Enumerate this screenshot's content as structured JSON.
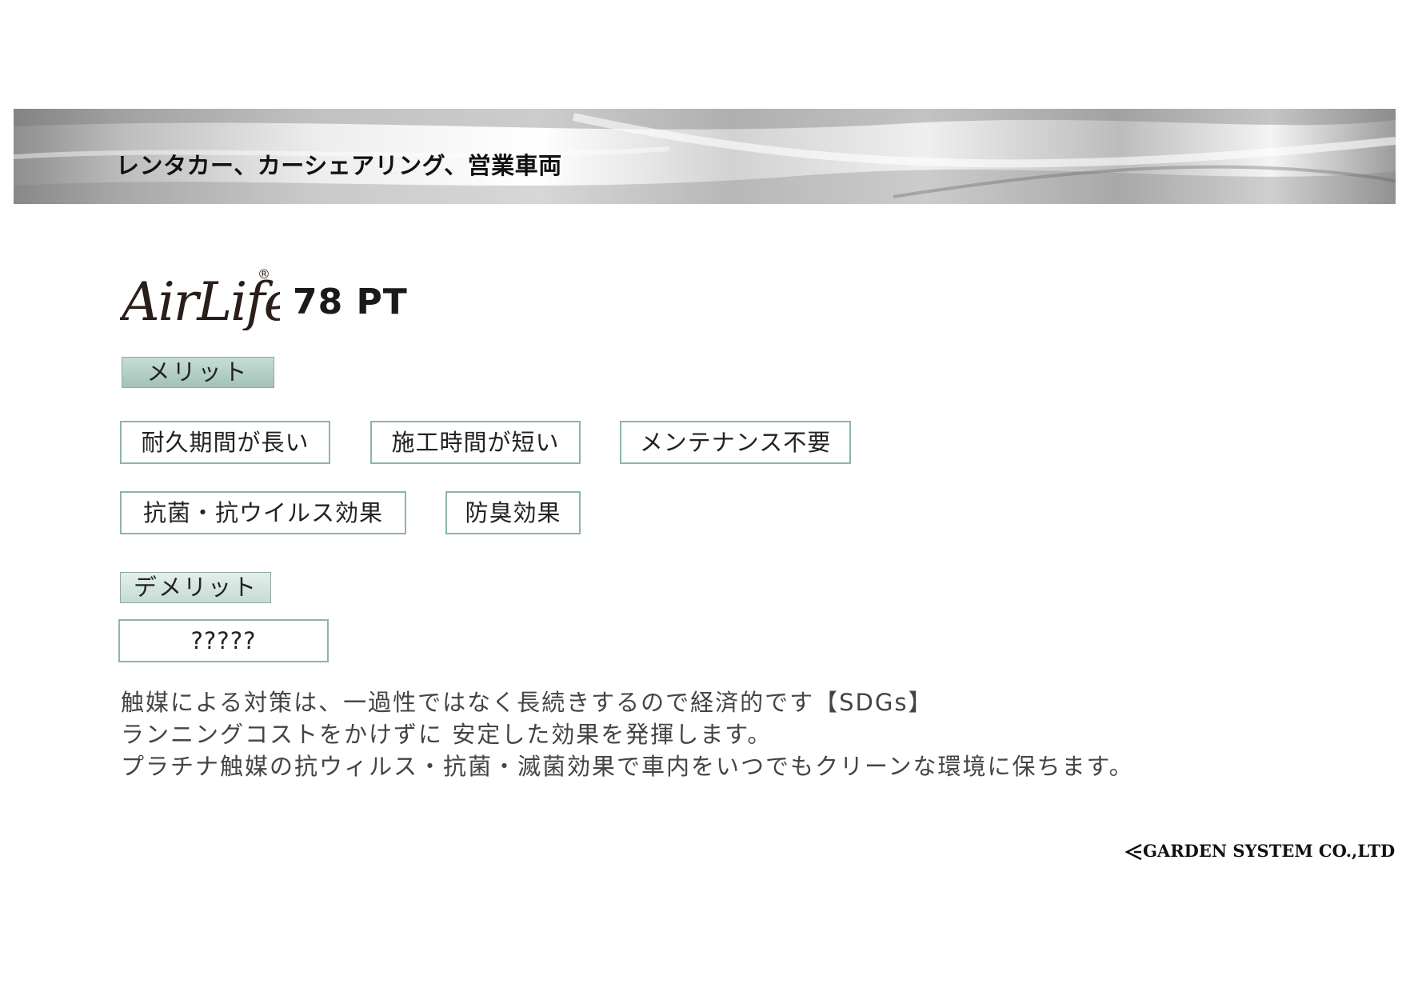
{
  "banner": {
    "title": "レンタカー、カーシェアリング、営業車両"
  },
  "logo": {
    "brand": "AirLife",
    "registered_mark": "®",
    "product": "78 PT"
  },
  "merit": {
    "label": "メリット",
    "tags": [
      "耐久期間が長い",
      "施工時間が短い",
      "メンテナンス不要",
      "抗菌・抗ウイルス効果",
      "防臭効果"
    ]
  },
  "demerit": {
    "label": "デメリット",
    "tags": [
      "?????"
    ]
  },
  "description": {
    "lines": [
      "触媒による対策は、一過性ではなく長続きするので経済的です【SDGs】",
      "ランニングコストをかけずに 安定した効果を発揮します。",
      "プラチナ触媒の抗ウィルス・抗菌・滅菌効果で車内をいつでもクリーンな環境に保ちます。"
    ]
  },
  "footer": {
    "company": "GARDEN SYSTEM CO.,LTD"
  }
}
